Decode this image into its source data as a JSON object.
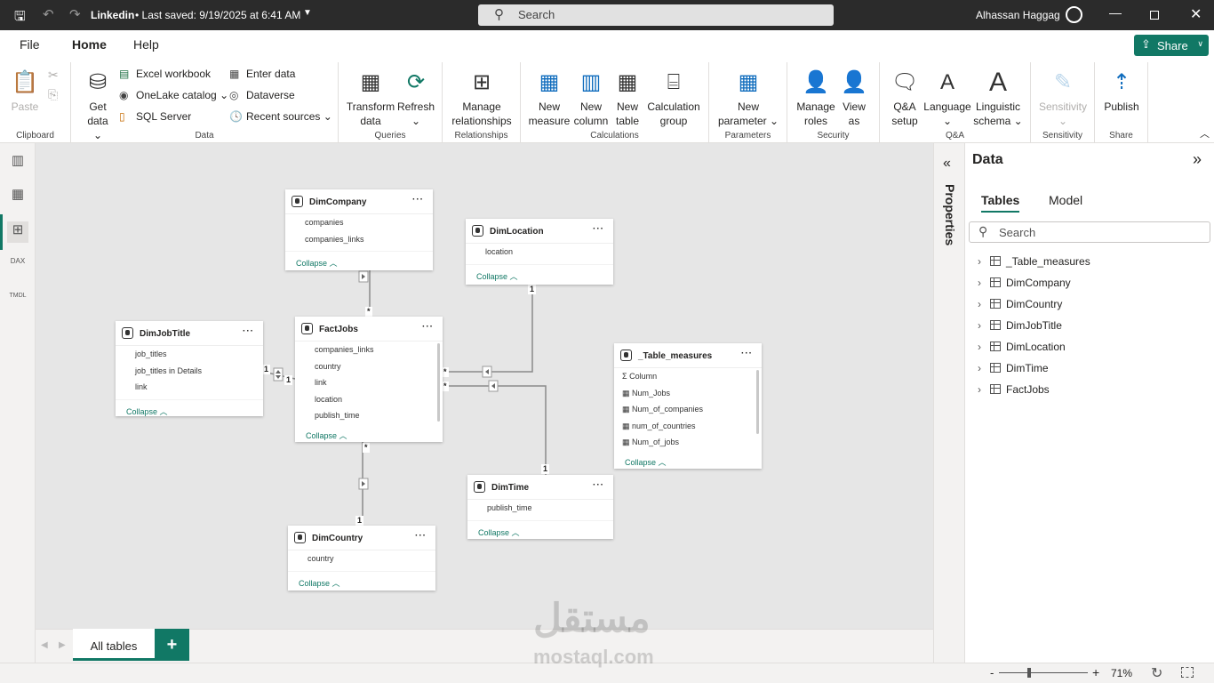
{
  "titlebar": {
    "file": "Linkedin",
    "saved": "• Last saved: 9/19/2025 at 6:41 AM",
    "search": "Search",
    "user": "Alhassan Haggag"
  },
  "menu": {
    "file": "File",
    "home": "Home",
    "help": "Help",
    "share": "Share"
  },
  "ribbon": {
    "clipboard": {
      "label": "Clipboard",
      "paste": "Paste"
    },
    "data": {
      "label": "Data",
      "get_data": "Get data",
      "excel": "Excel workbook",
      "onelake": "OneLake catalog",
      "sql": "SQL Server",
      "enter": "Enter data",
      "dataverse": "Dataverse",
      "recent": "Recent sources"
    },
    "queries": {
      "label": "Queries",
      "transform": "Transform data",
      "refresh": "Refresh"
    },
    "relationships": {
      "label": "Relationships",
      "manage": "Manage relationships"
    },
    "calculations": {
      "label": "Calculations",
      "measure": "New measure",
      "column": "New column",
      "table": "New table",
      "group": "Calculation group"
    },
    "parameters": {
      "label": "Parameters",
      "new": "New parameter"
    },
    "security": {
      "label": "Security",
      "roles": "Manage roles",
      "view": "View as"
    },
    "qa": {
      "label": "Q&A",
      "setup": "Q&A setup",
      "language": "Language",
      "schema": "Linguistic schema"
    },
    "sensitivity": {
      "label": "Sensitivity",
      "btn": "Sensitivity"
    },
    "share": {
      "label": "Share",
      "publish": "Publish"
    }
  },
  "tables": {
    "company": {
      "name": "DimCompany",
      "fields": [
        "companies",
        "companies_links"
      ]
    },
    "location": {
      "name": "DimLocation",
      "fields": [
        "location"
      ]
    },
    "jobtitle": {
      "name": "DimJobTitle",
      "fields": [
        "job_titles",
        "job_titles in Details",
        "link"
      ]
    },
    "fact": {
      "name": "FactJobs",
      "fields": [
        "companies_links",
        "country",
        "link",
        "location",
        "publish_time"
      ]
    },
    "measures": {
      "name": "_Table_measures",
      "fields": [
        "Column",
        "Num_Jobs",
        "Num_of_companies",
        "num_of_countries",
        "Num_of_jobs"
      ]
    },
    "time": {
      "name": "DimTime",
      "fields": [
        "publish_time"
      ]
    },
    "country": {
      "name": "DimCountry",
      "fields": [
        "country"
      ]
    },
    "collapse": "Collapse"
  },
  "cardinality": {
    "one": "1",
    "many": "*"
  },
  "bottom": {
    "tab": "All tables",
    "add": "+"
  },
  "properties": "Properties",
  "data_pane": {
    "title": "Data",
    "tab_tables": "Tables",
    "tab_model": "Model",
    "search": "Search",
    "items": [
      "_Table_measures",
      "DimCompany",
      "DimCountry",
      "DimJobTitle",
      "DimLocation",
      "DimTime",
      "FactJobs"
    ]
  },
  "status": {
    "zoom": "71%",
    "zoom_value": 71,
    "minus": "-",
    "plus": "+"
  },
  "watermark": {
    "arabic": "مستقل",
    "latin": "mostaql.com"
  }
}
